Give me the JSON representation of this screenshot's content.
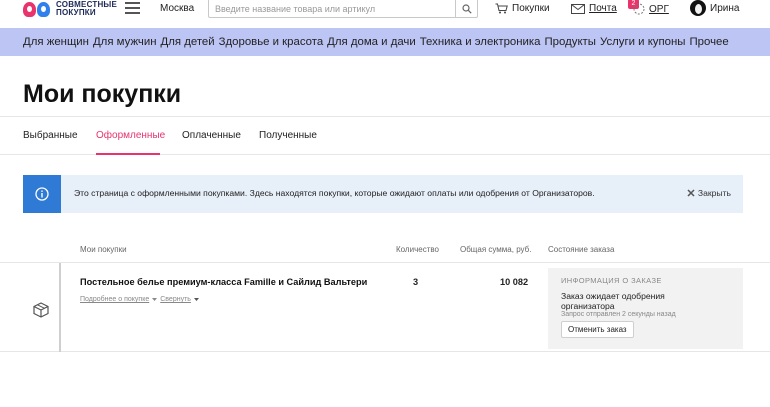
{
  "header": {
    "logo_text_line1": "СОВМЕСТНЫЕ",
    "logo_text_line2": "ПОКУПКИ",
    "city": "Москва",
    "search_placeholder": "Введите название товара или артикул",
    "purchases_link": "Покупки",
    "mail_link": "Почта",
    "org_badge": "2",
    "org_link": "ОРГ",
    "user_name": "Ирина"
  },
  "categories": [
    "Для женщин",
    "Для мужчин",
    "Для детей",
    "Здоровье и красота",
    "Для дома и дачи",
    "Техника и электроника",
    "Продукты",
    "Услуги и купоны",
    "Прочее"
  ],
  "page_title": "Мои покупки",
  "tabs": [
    {
      "label": "Выбранные",
      "active": false
    },
    {
      "label": "Оформленные",
      "active": true
    },
    {
      "label": "Оплаченные",
      "active": false
    },
    {
      "label": "Полученные",
      "active": false
    }
  ],
  "notice": {
    "text": "Это страница с оформленными покупками. Здесь находятся покупки, которые ожидают оплаты или одобрения от Организаторов.",
    "close_label": "Закрыть"
  },
  "table": {
    "columns": {
      "items": "Мои покупки",
      "qty": "Количество",
      "sum": "Общая сумма, руб.",
      "status": "Состояние заказа"
    },
    "rows": [
      {
        "name": "Постельное белье премиум-класса Famille и Сайлид Вальтери",
        "details_link": "Подробнее о покупке",
        "collapse_link": "Свернуть",
        "qty": "3",
        "sum": "10 082",
        "status_heading": "ИНФОРМАЦИЯ О ЗАКАЗЕ",
        "status_text": "Заказ ожидает одобрения организатора",
        "status_sub": "Запрос отправлен 2 секунды назад",
        "cancel_label": "Отменить заказ"
      }
    ]
  },
  "colors": {
    "accent": "#e8336d",
    "category_bar": "#bcc5f4",
    "notice_bg": "#e7eff9",
    "notice_icon": "#2e7ad4"
  }
}
